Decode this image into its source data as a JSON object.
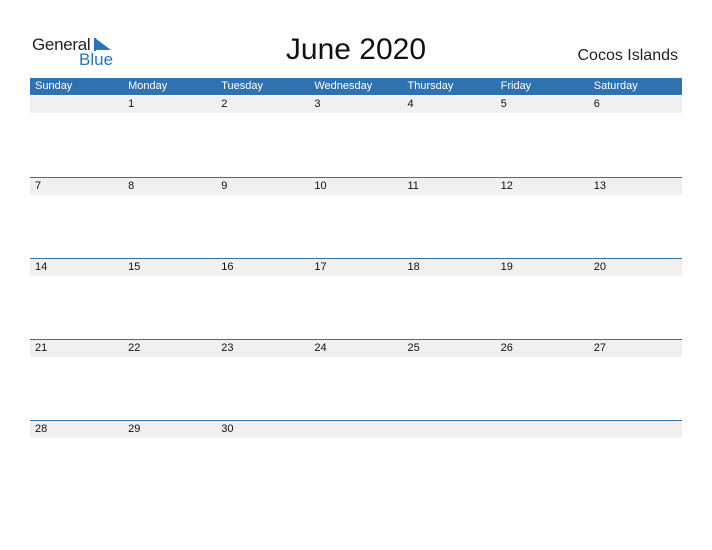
{
  "logo": {
    "line1": "General",
    "line2": "Blue"
  },
  "title": "June 2020",
  "country": "Cocos Islands",
  "colors": {
    "accent": "#2e72b2",
    "row_bg": "#f0f0f0"
  },
  "weekdays": [
    "Sunday",
    "Monday",
    "Tuesday",
    "Wednesday",
    "Thursday",
    "Friday",
    "Saturday"
  ],
  "weeks": [
    [
      "",
      "1",
      "2",
      "3",
      "4",
      "5",
      "6"
    ],
    [
      "7",
      "8",
      "9",
      "10",
      "11",
      "12",
      "13"
    ],
    [
      "14",
      "15",
      "16",
      "17",
      "18",
      "19",
      "20"
    ],
    [
      "21",
      "22",
      "23",
      "24",
      "25",
      "26",
      "27"
    ],
    [
      "28",
      "29",
      "30",
      "",
      "",
      "",
      ""
    ]
  ]
}
